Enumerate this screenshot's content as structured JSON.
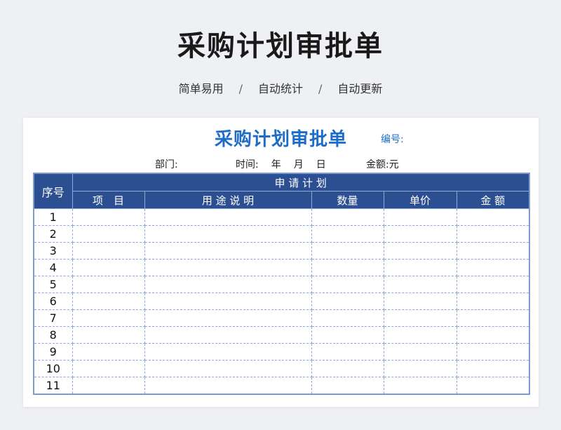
{
  "hero": {
    "title": "采购计划审批单",
    "tagline": [
      "简单易用",
      "自动统计",
      "自动更新"
    ],
    "separator": "/"
  },
  "form": {
    "title": "采购计划审批单",
    "number_label": "编号:",
    "dept_label": "部门:",
    "time_label": "时间:",
    "year": "年",
    "month": "月",
    "day": "日",
    "amount_label": "金额:",
    "amount_unit": "元"
  },
  "table": {
    "seq_header": "序号",
    "group_header": "申 请 计 划",
    "columns": [
      "项　目",
      "用 途 说 明",
      "数量",
      "单价",
      "金 额"
    ],
    "rows": [
      "1",
      "2",
      "3",
      "4",
      "5",
      "6",
      "7",
      "8",
      "9",
      "10",
      "11"
    ]
  },
  "colors": {
    "accent": "#1c6cc8",
    "header_bg": "#2c4f91",
    "grid_line": "#8fa8d6",
    "page_bg": "#eef0f3"
  }
}
